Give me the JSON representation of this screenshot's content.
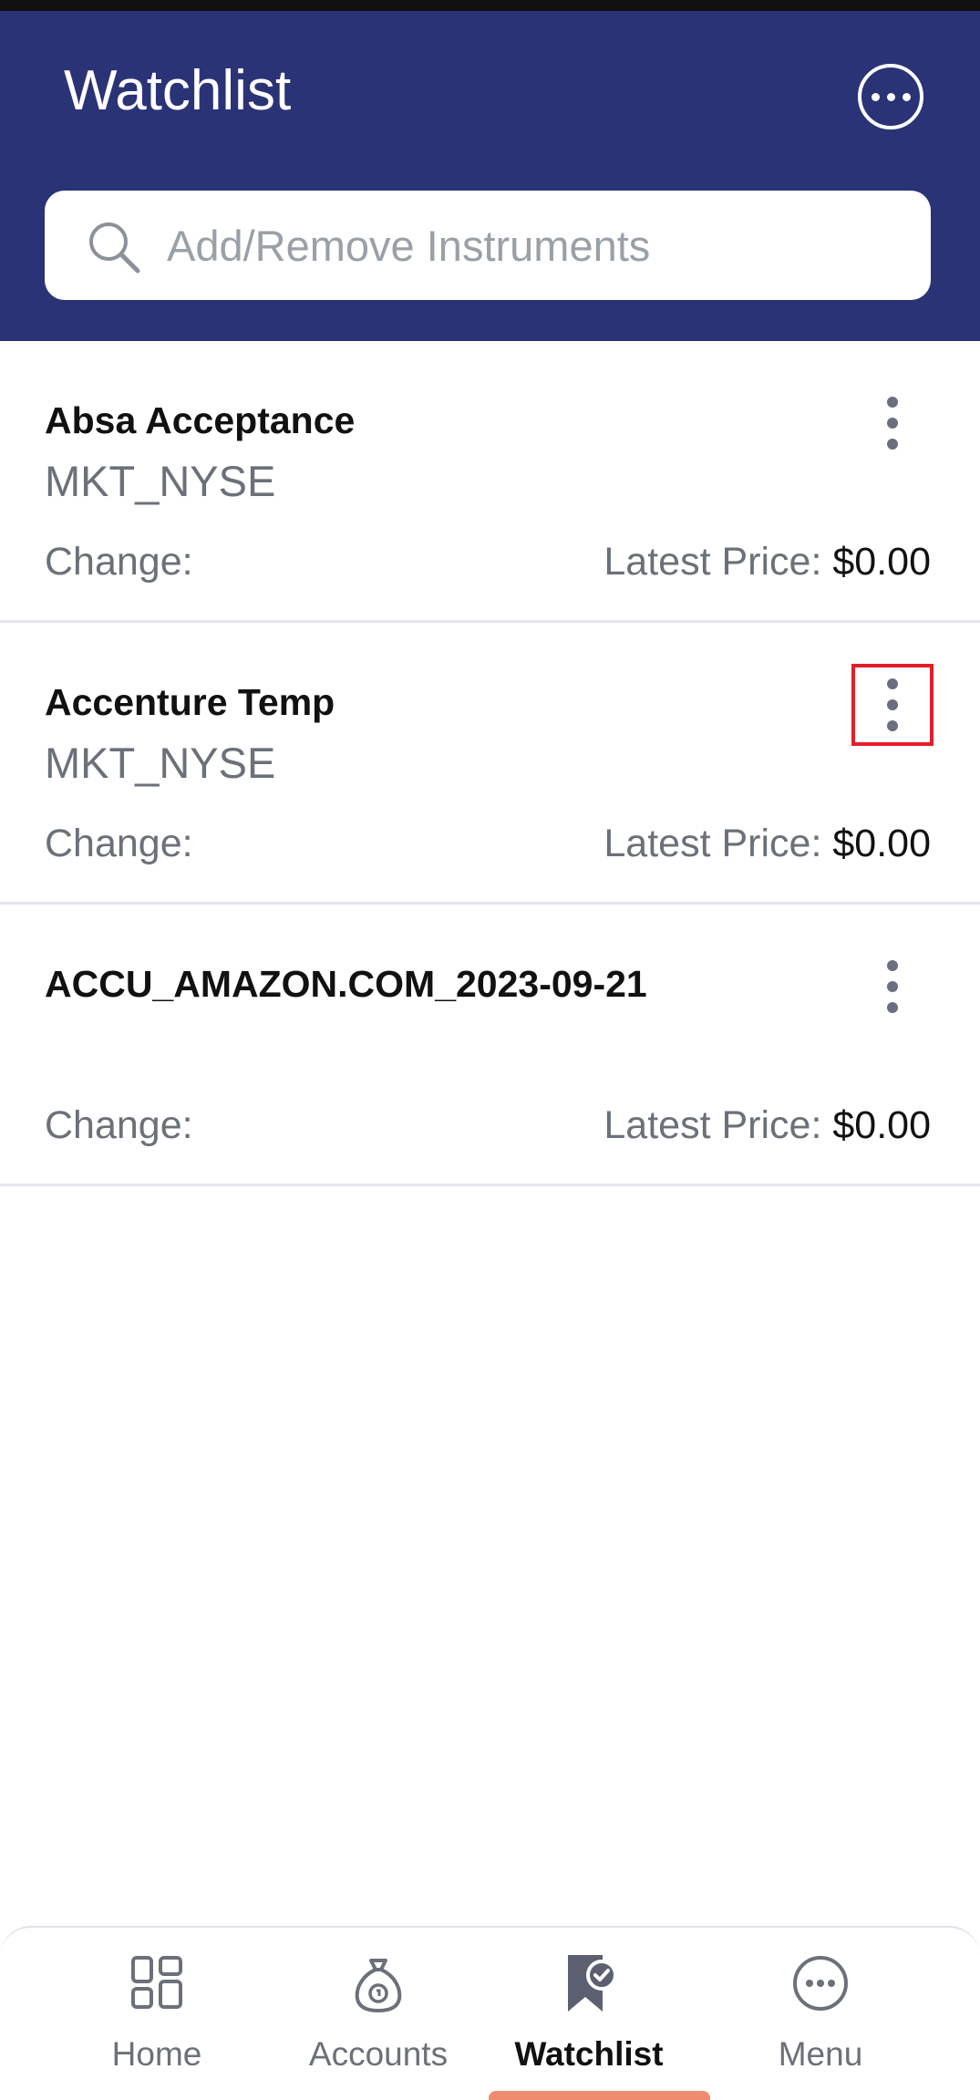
{
  "header": {
    "title": "Watchlist",
    "more_icon": "more-horizontal-circle-icon"
  },
  "search": {
    "placeholder": "Add/Remove Instruments",
    "value": "",
    "icon": "search-icon"
  },
  "instruments": [
    {
      "name": "Absa Acceptance",
      "market": "MKT_NYSE",
      "change_label": "Change:",
      "price_label": "Latest Price:",
      "price_value": "$0.00"
    },
    {
      "name": "Accenture Temp",
      "market": "MKT_NYSE",
      "change_label": "Change:",
      "price_label": "Latest Price:",
      "price_value": "$0.00",
      "highlighted_menu": true
    },
    {
      "name": "ACCU_AMAZON.COM_2023-09-21",
      "market": "",
      "change_label": "Change:",
      "price_label": "Latest Price:",
      "price_value": "$0.00"
    }
  ],
  "bottom_nav": {
    "items": [
      {
        "label": "Home",
        "icon": "home-grid-icon"
      },
      {
        "label": "Accounts",
        "icon": "money-bag-icon"
      },
      {
        "label": "Watchlist",
        "icon": "bookmark-check-icon",
        "active": true
      },
      {
        "label": "Menu",
        "icon": "more-circle-icon"
      }
    ]
  },
  "colors": {
    "header_bg": "#2b3377",
    "accent": "#ef8b6f",
    "highlight": "#e21e2a",
    "text_primary": "#111111",
    "text_secondary": "#6b7079"
  }
}
